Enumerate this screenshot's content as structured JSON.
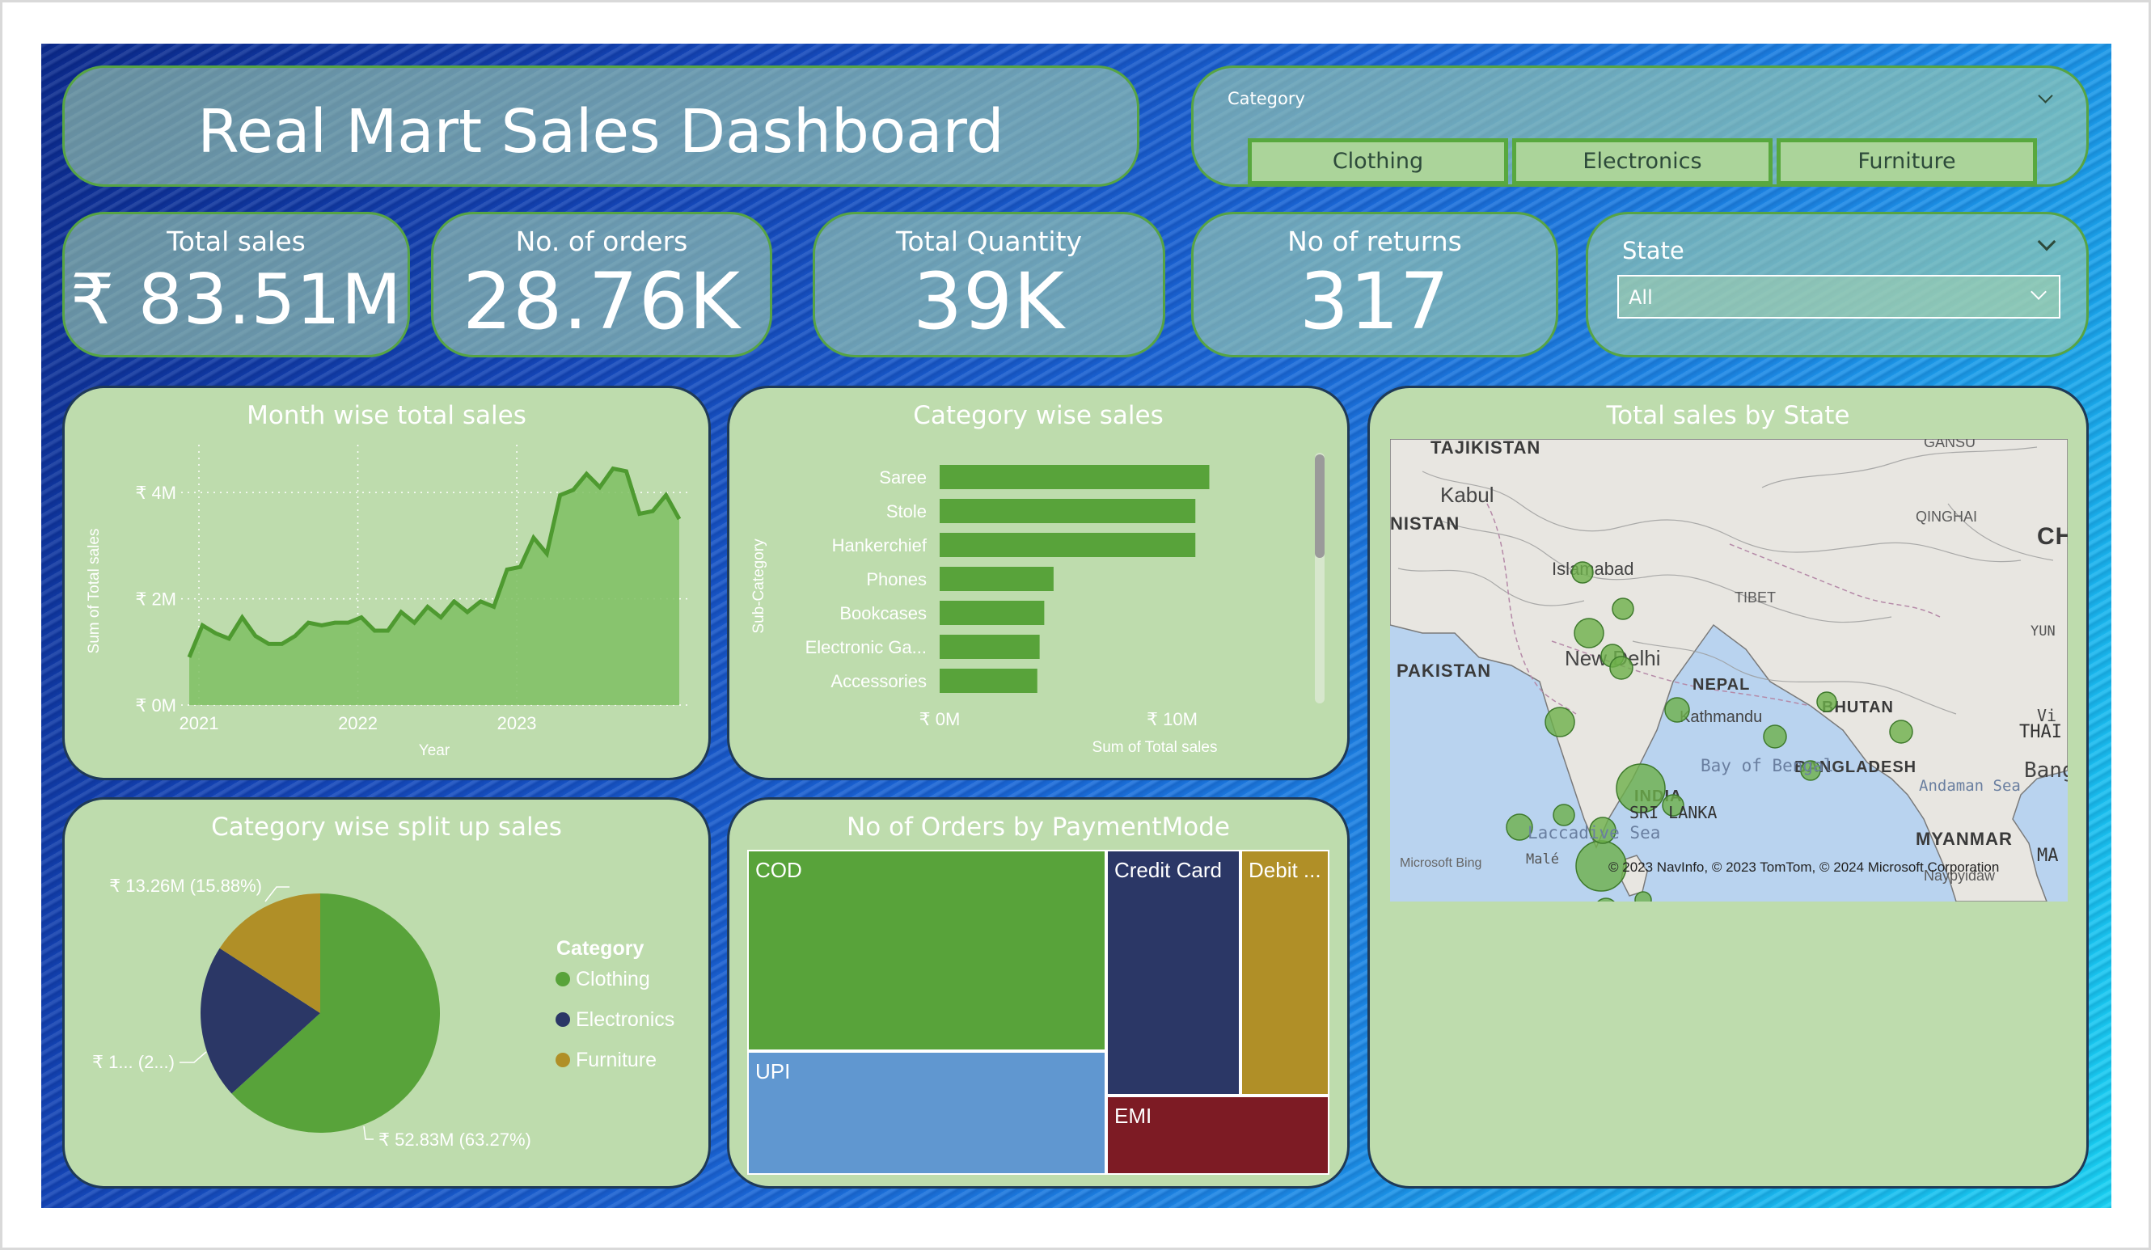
{
  "header": {
    "title": "Real Mart Sales Dashboard"
  },
  "category_slicer": {
    "title": "Category",
    "options": [
      "Clothing",
      "Electronics",
      "Furniture"
    ]
  },
  "kpis": [
    {
      "label": "Total sales",
      "value": "₹ 83.51M"
    },
    {
      "label": "No. of orders",
      "value": "28.76K"
    },
    {
      "label": "Total Quantity",
      "value": "39K"
    },
    {
      "label": "No of returns",
      "value": "317"
    }
  ],
  "state_slicer": {
    "title": "State",
    "selected": "All"
  },
  "month_chart": {
    "title": "Month wise total sales",
    "chart_data": {
      "type": "area",
      "xlabel": "Year",
      "ylabel": "Sum of Total sales",
      "x_ticks": [
        "2021",
        "2022",
        "2023"
      ],
      "y_ticks": [
        "₹ 0M",
        "₹ 2M",
        "₹ 4M"
      ],
      "ylim": [
        0,
        4.9
      ],
      "units": "₹ M",
      "values": [
        0.9,
        1.5,
        1.35,
        1.25,
        1.65,
        1.3,
        1.15,
        1.15,
        1.3,
        1.55,
        1.5,
        1.55,
        1.55,
        1.65,
        1.4,
        1.4,
        1.75,
        1.55,
        1.85,
        1.65,
        1.95,
        1.75,
        1.95,
        1.85,
        2.55,
        2.6,
        3.15,
        2.85,
        3.95,
        4.05,
        4.35,
        4.1,
        4.45,
        4.4,
        3.6,
        3.65,
        3.95,
        3.5
      ]
    }
  },
  "category_bar": {
    "title": "Category wise sales",
    "chart_data": {
      "type": "bar",
      "orientation": "horizontal",
      "xlabel": "Sum of Total sales",
      "ylabel": "Sub-Category",
      "x_ticks": [
        "₹ 0M",
        "₹ 10M"
      ],
      "xlim": [
        0,
        16
      ],
      "categories": [
        "Saree",
        "Stole",
        "Hankerchief",
        "Phones",
        "Bookcases",
        "Electronic Ga...",
        "Accessories"
      ],
      "values": [
        11.6,
        11.0,
        11.0,
        4.9,
        4.5,
        4.3,
        4.2
      ]
    }
  },
  "pie_chart": {
    "title": "Category wise split up sales",
    "legend_title": "Category",
    "chart_data": {
      "type": "pie",
      "labels": [
        "Clothing",
        "Electronics",
        "Furniture"
      ],
      "values": [
        52.83,
        17.42,
        13.26
      ],
      "percent": [
        63.27,
        20.85,
        15.88
      ],
      "colors": [
        "#58a33a",
        "#2b3766",
        "#b08f27"
      ],
      "data_labels": [
        "₹ 52.83M (63.27%)",
        "₹ 1... (2...)",
        "₹ 13.26M (15.88%)"
      ]
    }
  },
  "treemap": {
    "title": "No of Orders by PaymentMode",
    "chart_data": {
      "type": "treemap",
      "labels": [
        "COD",
        "UPI",
        "Credit Card",
        "EMI",
        "Debit ..."
      ],
      "colors": [
        "#58a33a",
        "#6097d0",
        "#2b3766",
        "#7d1b24",
        "#b08f27"
      ]
    }
  },
  "map": {
    "title": "Total sales by State",
    "labels": [
      "TAJIKISTAN",
      "Kabul",
      "NISTAN",
      "Islamabad",
      "PAKISTAN",
      "New Delhi",
      "NEPAL",
      "Kathmandu",
      "TIBET",
      "QINGHAI",
      "GANSU",
      "CH",
      "BHUTAN",
      "BANGLADESH",
      "INDIA",
      "MYANMAR",
      "Naypyidaw",
      "Bay of Bengal",
      "Andaman Sea",
      "SRI LANKA",
      "Laccadive Sea",
      "THAI",
      "Bangk",
      "YUN",
      "Vi",
      "L",
      "MA",
      "Malé",
      "a",
      "s"
    ],
    "attribution": "© 2023 NavInfo, © 2023 TomTom, © 2024 Microsoft Corporation",
    "logo_text": "Microsoft Bing",
    "bubble_color": "#6db04a"
  }
}
